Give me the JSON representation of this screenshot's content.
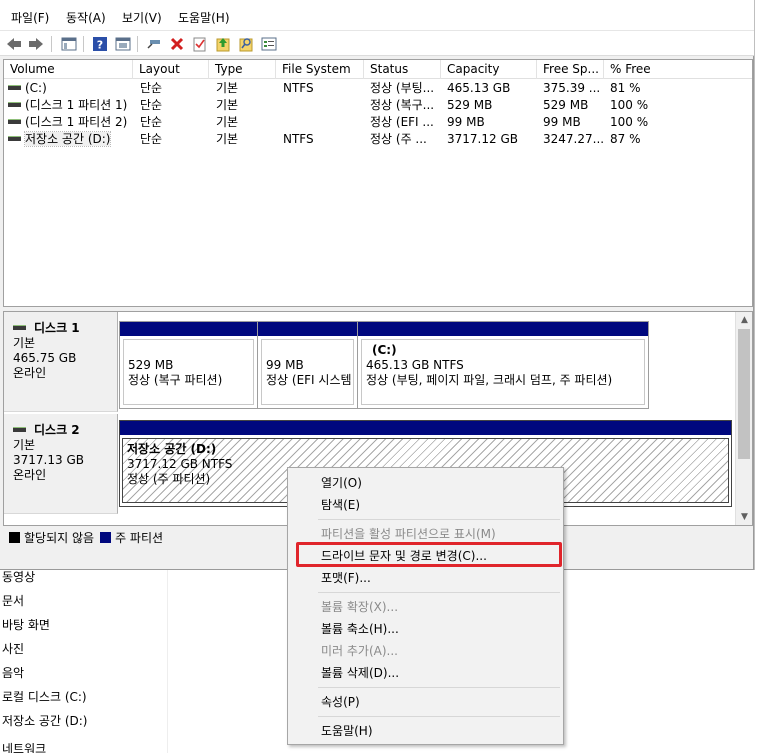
{
  "menu": [
    "파일(F)",
    "동작(A)",
    "보기(V)",
    "도움말(H)"
  ],
  "toolbar_icons": [
    "back-icon",
    "forward-icon",
    "console-tree-icon",
    "help-icon",
    "properties-icon",
    "connect-icon",
    "delete-icon",
    "check-icon",
    "up-icon",
    "search-icon",
    "list-icon"
  ],
  "columns": [
    "Volume",
    "Layout",
    "Type",
    "File System",
    "Status",
    "Capacity",
    "Free Sp...",
    "% Free"
  ],
  "volumes": [
    {
      "volume": "(C:)",
      "layout": "단순",
      "type": "기본",
      "fs": "NTFS",
      "status": "정상 (부팅...",
      "capacity": "465.13 GB",
      "free": "375.39 ...",
      "pct": "81 %"
    },
    {
      "volume": "(디스크 1 파티션 1)",
      "layout": "단순",
      "type": "기본",
      "fs": "",
      "status": "정상 (복구...",
      "capacity": "529 MB",
      "free": "529 MB",
      "pct": "100 %"
    },
    {
      "volume": "(디스크 1 파티션 2)",
      "layout": "단순",
      "type": "기본",
      "fs": "",
      "status": "정상 (EFI ...",
      "capacity": "99 MB",
      "free": "99 MB",
      "pct": "100 %"
    },
    {
      "volume": "저장소 공간 (D:)",
      "layout": "단순",
      "type": "기본",
      "fs": "NTFS",
      "status": "정상 (주 ...",
      "capacity": "3717.12 GB",
      "free": "3247.27...",
      "pct": "87 %"
    }
  ],
  "disk1": {
    "name": "디스크 1",
    "type": "기본",
    "size": "465.75 GB",
    "state": "온라인",
    "partitions": [
      {
        "title": "",
        "size": "529 MB",
        "status": "정상 (복구 파티션)"
      },
      {
        "title": "",
        "size": "99 MB",
        "status": "정상 (EFI 시스템"
      },
      {
        "title": "(C:)",
        "size": "465.13 GB NTFS",
        "status": "정상 (부팅, 페이지 파일, 크래시 덤프, 주 파티션)"
      }
    ]
  },
  "disk2": {
    "name": "디스크 2",
    "type": "기본",
    "size": "3717.13 GB",
    "state": "온라인",
    "partition": {
      "title": "저장소 공간  (D:)",
      "size": "3717.12 GB NTFS",
      "status": "정상 (주 파티션)"
    }
  },
  "legend": {
    "unallocated": "할당되지 않음",
    "primary": "주 파티션",
    "unallocated_color": "#000000",
    "primary_color": "#00087e"
  },
  "context_menu": {
    "open": "열기(O)",
    "explore": "탐색(E)",
    "mark_active": "파티션을 활성 파티션으로 표시(M)",
    "change_letter": "드라이브 문자 및 경로 변경(C)...",
    "format": "포맷(F)...",
    "extend": "볼륨 확장(X)...",
    "shrink": "볼륨 축소(H)...",
    "mirror": "미러 추가(A)...",
    "delete": "볼륨 삭제(D)...",
    "properties": "속성(P)",
    "help": "도움말(H)"
  },
  "nav_tree": [
    "동영상",
    "문서",
    "바탕 화면",
    "사진",
    "음악",
    "로컬 디스크 (C:)",
    "저장소 공간 (D:)",
    "네트워크"
  ],
  "highlight_color": "#e0252b"
}
